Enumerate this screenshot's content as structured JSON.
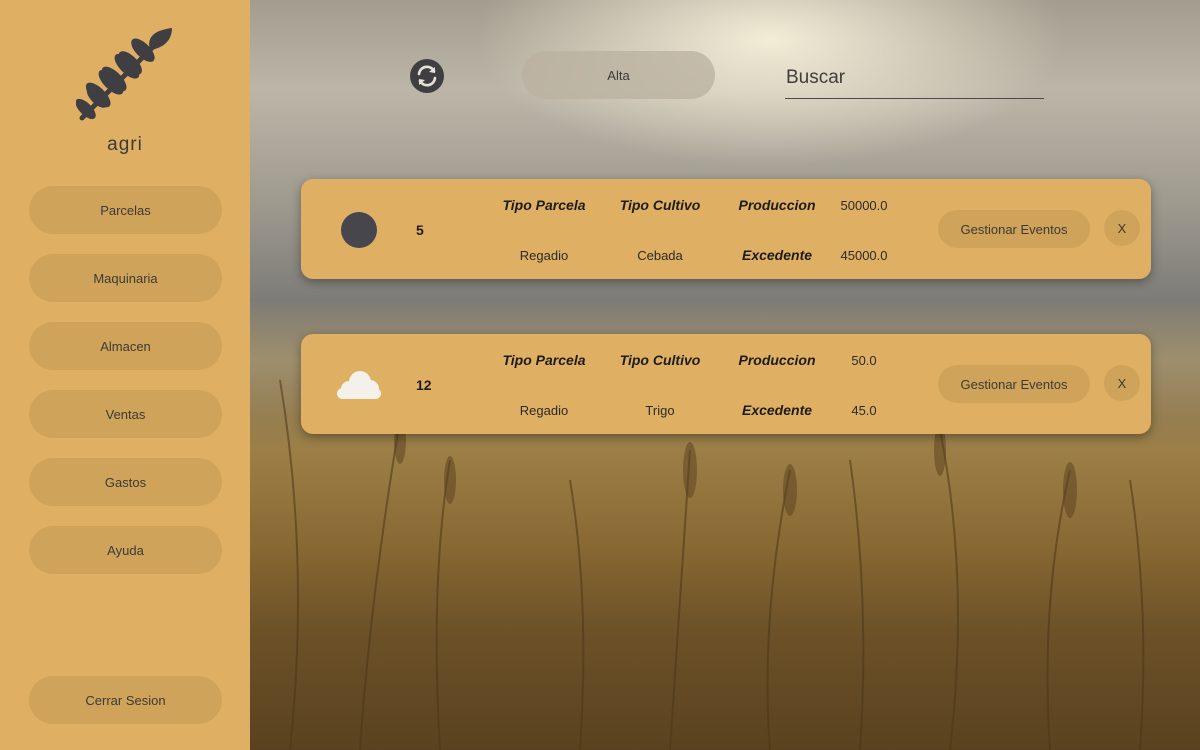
{
  "sidebar": {
    "brand": "agri",
    "logo_icon": "wheat-icon",
    "items": [
      {
        "label": "Parcelas"
      },
      {
        "label": "Maquinaria"
      },
      {
        "label": "Almacen"
      },
      {
        "label": "Ventas"
      },
      {
        "label": "Gastos"
      },
      {
        "label": "Ayuda"
      }
    ],
    "logout_label": "Cerrar Sesion"
  },
  "toolbar": {
    "refresh_icon": "refresh-icon",
    "alta_label": "Alta",
    "search_placeholder": "Buscar"
  },
  "parcelas": [
    {
      "weather_icon": "moon-icon",
      "id": "5",
      "tipo_parcela_header": "Tipo Parcela",
      "tipo_parcela": "Regadio",
      "tipo_cultivo_header": "Tipo Cultivo",
      "tipo_cultivo": "Cebada",
      "produccion_header": "Produccion",
      "produccion": "50000.0",
      "excedente_header": "Excedente",
      "excedente": "45000.0",
      "events_label": "Gestionar Eventos",
      "delete_label": "X"
    },
    {
      "weather_icon": "cloud-icon",
      "id": "12",
      "tipo_parcela_header": "Tipo Parcela",
      "tipo_parcela": "Regadio",
      "tipo_cultivo_header": "Tipo Cultivo",
      "tipo_cultivo": "Trigo",
      "produccion_header": "Produccion",
      "produccion": "50.0",
      "excedente_header": "Excedente",
      "excedente": "45.0",
      "events_label": "Gestionar Eventos",
      "delete_label": "X"
    }
  ],
  "colors": {
    "sidebar": "#dfb063",
    "button": "#cfa35a",
    "card": "#dfb063",
    "icon_dark": "#3f3f43"
  }
}
